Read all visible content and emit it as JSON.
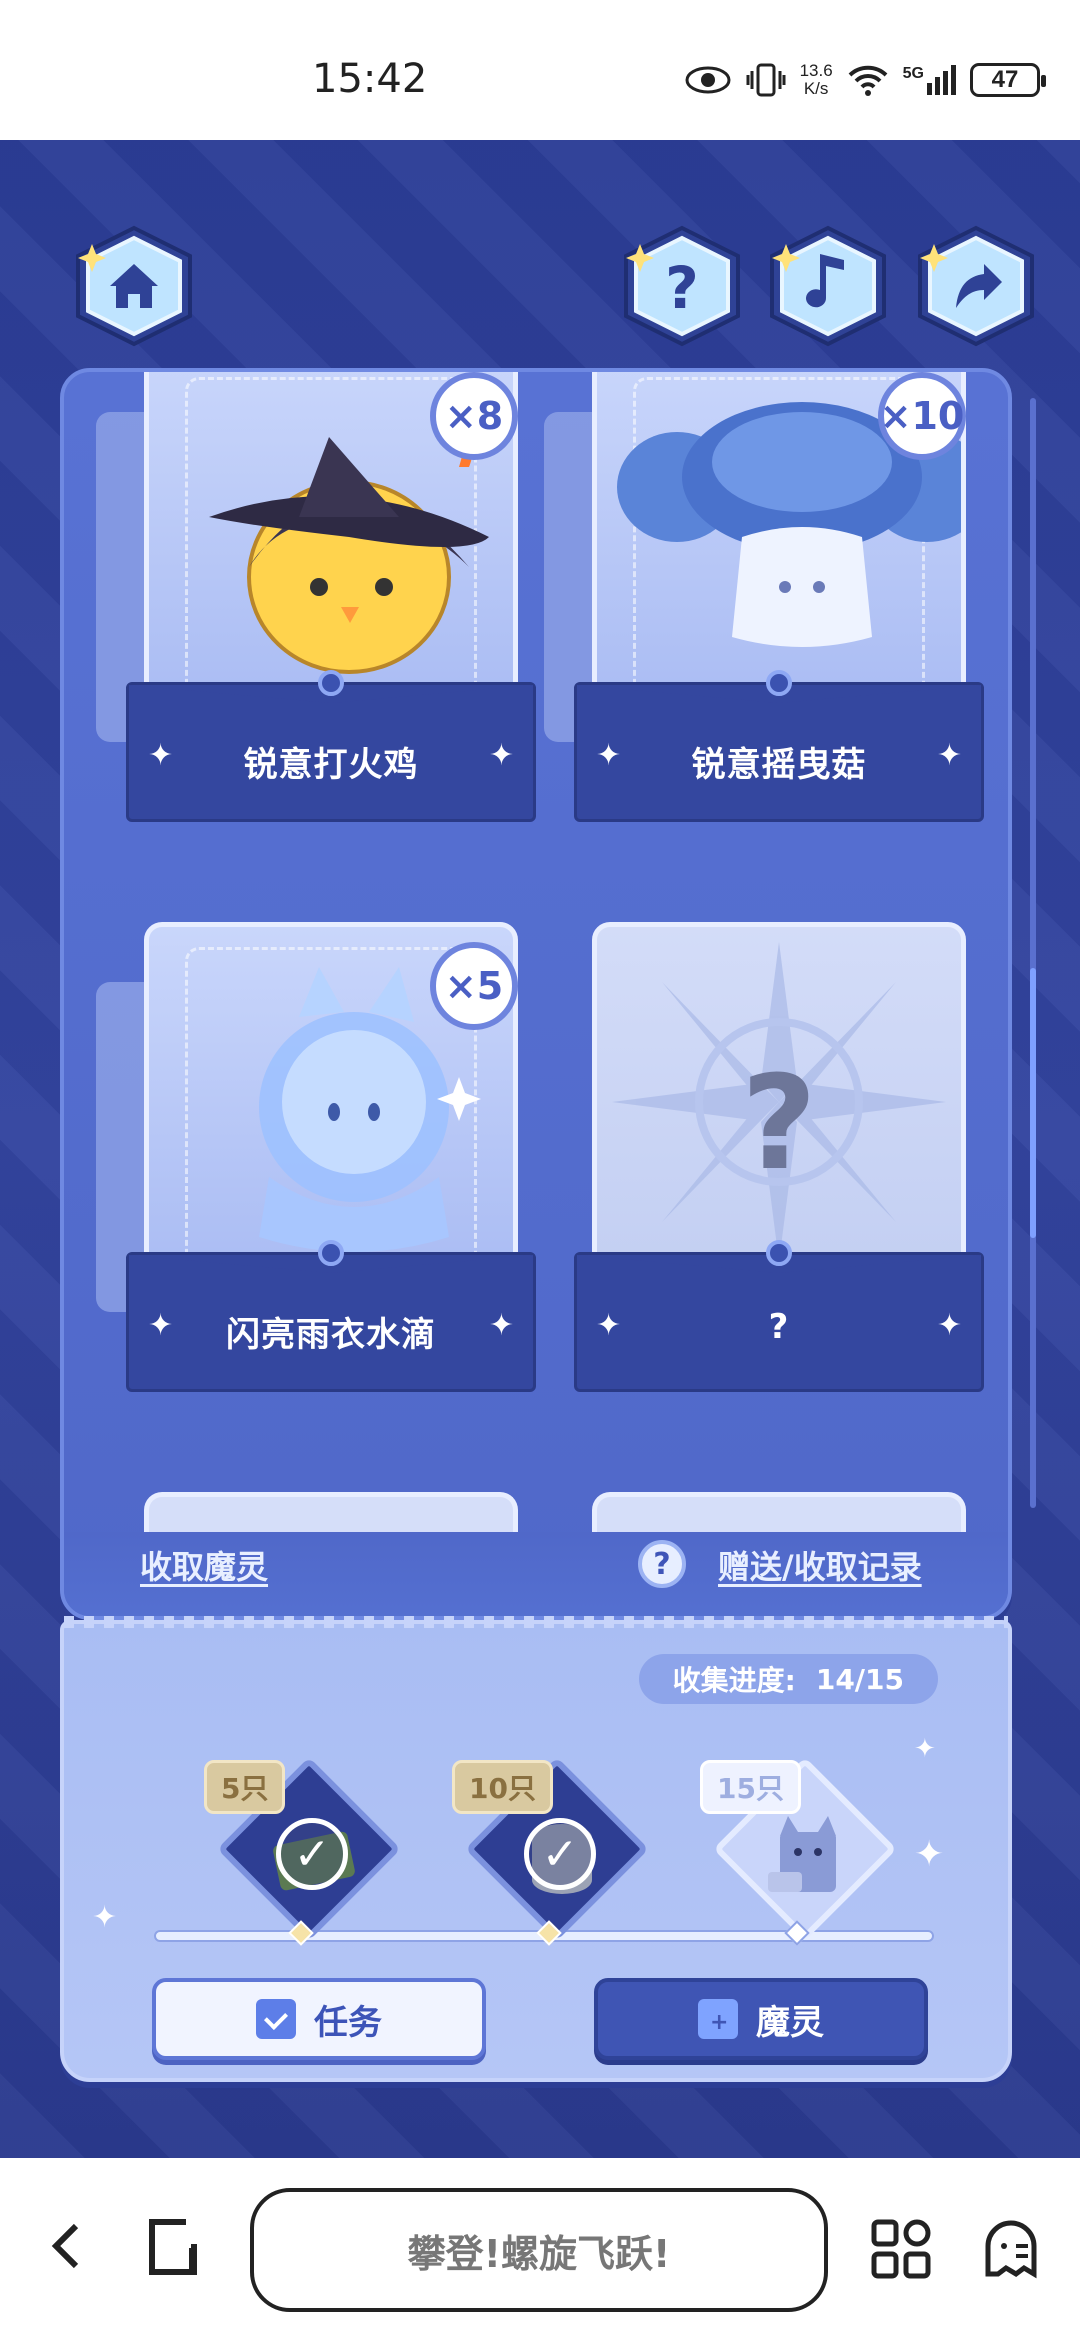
{
  "status_bar": {
    "time": "15:42",
    "net_speed_value": "13.6",
    "net_speed_unit": "K/s",
    "signal": "5G",
    "battery": "47"
  },
  "top_buttons": {
    "home_icon": "home-icon",
    "help_icon": "question-icon",
    "music_icon": "music-note-icon",
    "share_icon": "share-arrow-icon"
  },
  "cards": [
    {
      "name": "锐意打火鸡",
      "count": "×8",
      "mascot": "chick-witch-hat"
    },
    {
      "name": "锐意摇曳菇",
      "count": "×10",
      "mascot": "mushroom-ghost"
    },
    {
      "name": "闪亮雨衣水滴",
      "count": "×5",
      "mascot": "water-drop-raincoat"
    },
    {
      "name": "?",
      "count": "",
      "mascot": "unknown"
    }
  ],
  "panel_links": {
    "claim": "收取魔灵",
    "records": "赠送/收取记录",
    "help_symbol": "?"
  },
  "collection": {
    "progress_label": "收集进度:",
    "progress_value": "14/15",
    "progress_fraction": 0.933,
    "milestones": [
      {
        "label": "5只",
        "claimed": true,
        "reward": "cash-stack"
      },
      {
        "label": "10只",
        "claimed": true,
        "reward": "coin-stack"
      },
      {
        "label": "15只",
        "claimed": false,
        "reward": "cat-box"
      }
    ]
  },
  "buttons": {
    "task": "任务",
    "spirit": "魔灵"
  },
  "browser_bar": {
    "title": "攀登!螺旋飞跃!",
    "colors": {
      "accent": "#3d54b8",
      "bg": "#2b3d96"
    }
  }
}
